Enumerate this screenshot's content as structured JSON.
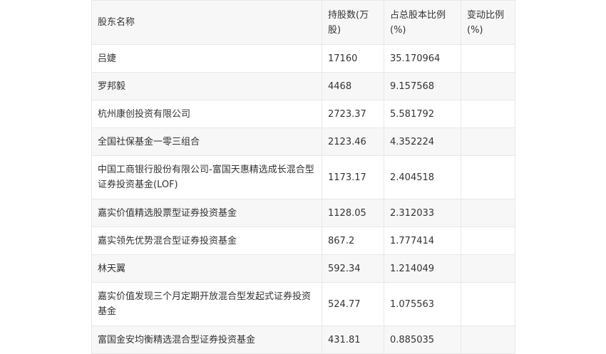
{
  "table": {
    "headers": [
      "股东名称",
      "持股数(万股)",
      "占总股本比例(%)",
      "变动比例(%)"
    ],
    "rows": [
      {
        "name": "吕婕",
        "shares": "17160",
        "ratio": "35.170964",
        "change": ""
      },
      {
        "name": "罗邦毅",
        "shares": "4468",
        "ratio": "9.157568",
        "change": ""
      },
      {
        "name": "杭州康创投资有限公司",
        "shares": "2723.37",
        "ratio": "5.581792",
        "change": ""
      },
      {
        "name": "全国社保基金一零三组合",
        "shares": "2123.46",
        "ratio": "4.352224",
        "change": ""
      },
      {
        "name": "中国工商银行股份有限公司-富国天惠精选成长混合型证券投资基金(LOF)",
        "shares": "1173.17",
        "ratio": "2.404518",
        "change": ""
      },
      {
        "name": "嘉实价值精选股票型证券投资基金",
        "shares": "1128.05",
        "ratio": "2.312033",
        "change": ""
      },
      {
        "name": "嘉实领先优势混合型证券投资基金",
        "shares": "867.2",
        "ratio": "1.777414",
        "change": ""
      },
      {
        "name": "林天翼",
        "shares": "592.34",
        "ratio": "1.214049",
        "change": ""
      },
      {
        "name": "嘉实价值发现三个月定期开放混合型发起式证券投资基金",
        "shares": "524.77",
        "ratio": "1.075563",
        "change": ""
      },
      {
        "name": "富国金安均衡精选混合型证券投资基金",
        "shares": "431.81",
        "ratio": "0.885035",
        "change": ""
      }
    ]
  }
}
